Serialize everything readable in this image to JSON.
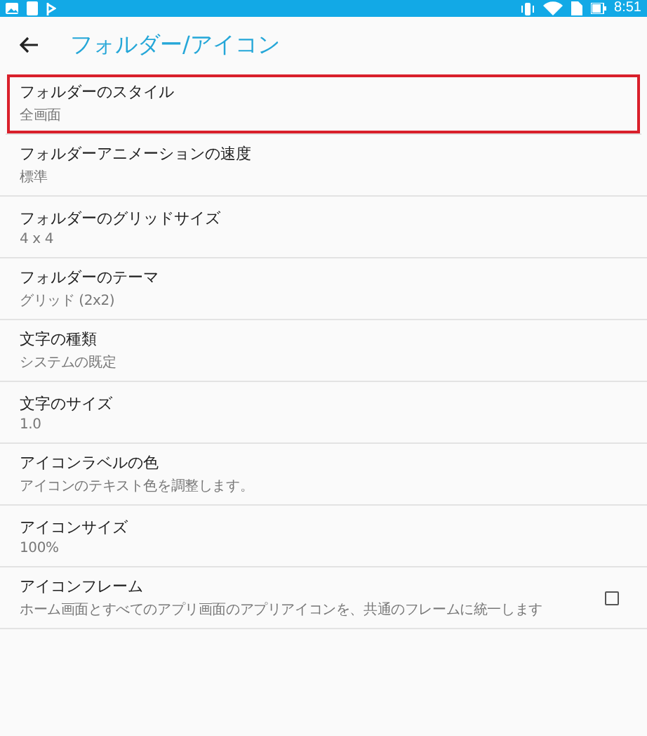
{
  "status_bar": {
    "time": "8:51"
  },
  "app_bar": {
    "title": "フォルダー/アイコン"
  },
  "settings": [
    {
      "kind": "value",
      "title": "フォルダーのスタイル",
      "summary": "全画面",
      "highlighted": true
    },
    {
      "kind": "value",
      "title": "フォルダーアニメーションの速度",
      "summary": "標準",
      "highlighted": false
    },
    {
      "kind": "value",
      "title": "フォルダーのグリッドサイズ",
      "summary": "4 x 4",
      "highlighted": false
    },
    {
      "kind": "value",
      "title": "フォルダーのテーマ",
      "summary": "グリッド (2x2)",
      "highlighted": false
    },
    {
      "kind": "value",
      "title": "文字の種類",
      "summary": "システムの既定",
      "highlighted": false
    },
    {
      "kind": "value",
      "title": "文字のサイズ",
      "summary": "1.0",
      "highlighted": false
    },
    {
      "kind": "value",
      "title": "アイコンラベルの色",
      "summary": "アイコンのテキスト色を調整します。",
      "highlighted": false
    },
    {
      "kind": "value",
      "title": "アイコンサイズ",
      "summary": "100%",
      "highlighted": false
    },
    {
      "kind": "checkbox",
      "title": "アイコンフレーム",
      "summary": "ホーム画面とすべてのアプリ画面のアプリアイコンを、共通のフレームに統一します",
      "checked": false,
      "highlighted": false
    }
  ]
}
